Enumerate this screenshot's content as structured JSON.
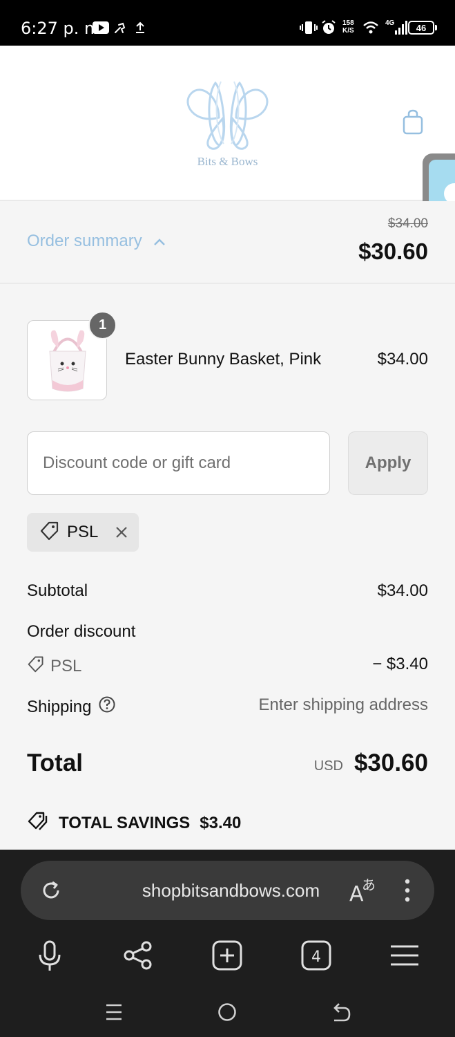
{
  "status_bar": {
    "time": "6:27 p. m.",
    "net_speed_value": "158",
    "net_speed_unit": "K/S",
    "network": "4G",
    "battery": "46"
  },
  "header": {
    "brand": "Bits & Bows",
    "logo_color": "#b9d6ee"
  },
  "summary": {
    "toggle_label": "Order summary",
    "original_price": "$34.00",
    "price": "$30.60"
  },
  "product": {
    "quantity": "1",
    "name": "Easter Bunny Basket, Pink",
    "price": "$34.00"
  },
  "discount": {
    "placeholder": "Discount code or gift card",
    "apply_label": "Apply",
    "applied_code": "PSL"
  },
  "totals": {
    "subtotal_label": "Subtotal",
    "subtotal_value": "$34.00",
    "order_discount_label": "Order discount",
    "discount_code": "PSL",
    "discount_value": "− $3.40",
    "shipping_label": "Shipping",
    "shipping_value": "Enter shipping address",
    "total_label": "Total",
    "currency": "USD",
    "total_value": "$30.60",
    "savings_label": "TOTAL SAVINGS",
    "savings_value": "$3.40"
  },
  "browser": {
    "url": "shopbitsandbows.com",
    "tab_count": "4"
  },
  "colors": {
    "accent": "#96bfe0",
    "browser_bg": "#1e1e1e",
    "url_bar_bg": "#3a3a3a"
  }
}
